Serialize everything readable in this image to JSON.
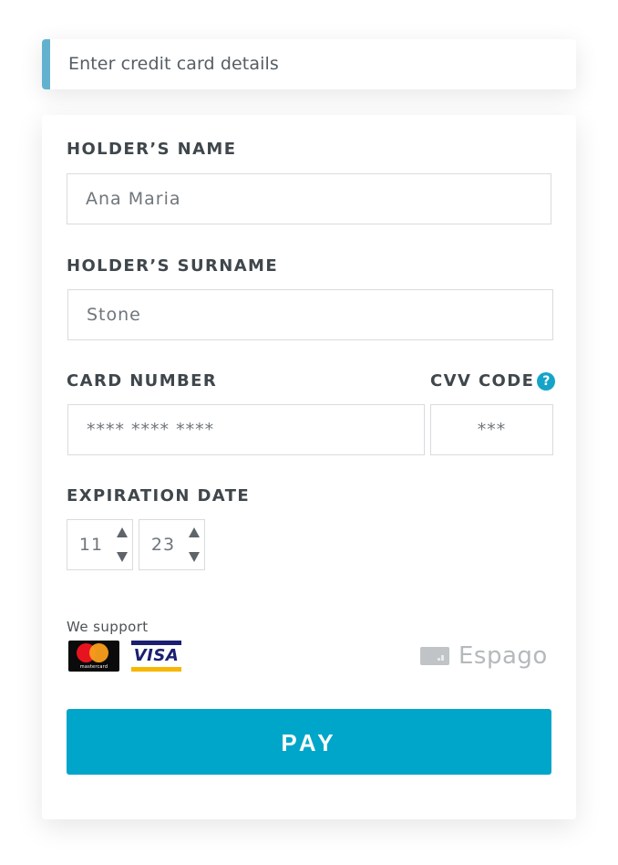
{
  "header": {
    "title": "Enter credit card details"
  },
  "form": {
    "holder_name": {
      "label": "HOLDER’S NAME",
      "value": "Ana Maria"
    },
    "holder_surname": {
      "label": "HOLDER’S SURNAME",
      "value": "Stone"
    },
    "card_number": {
      "label": "CARD NUMBER",
      "value": "**** **** ****"
    },
    "cvv": {
      "label": "CVV CODE",
      "value": "***",
      "help_icon": "question-mark-icon",
      "help_glyph": "?"
    },
    "expiration": {
      "label": "EXPIRATION DATE",
      "month": "11",
      "year": "23"
    }
  },
  "support": {
    "label": "We support",
    "brands": [
      {
        "name": "mastercard",
        "text": "mastercard"
      },
      {
        "name": "visa",
        "text": "VISA"
      }
    ]
  },
  "provider": {
    "name": "Espago"
  },
  "pay_button": {
    "label": "PAY"
  },
  "colors": {
    "accent": "#00a6c9",
    "header_accent": "#62b2cf",
    "label_text": "#3f474c",
    "help_icon": "#15a4c7"
  }
}
